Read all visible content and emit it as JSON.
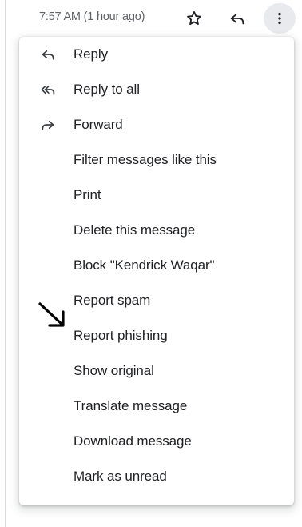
{
  "header": {
    "timestamp": "7:57 AM (1 hour ago)",
    "star_icon": "star-outline-icon",
    "reply_icon": "reply-icon",
    "more_icon": "more-vertical-icon"
  },
  "menu": {
    "items": [
      {
        "label": "Reply",
        "icon": "reply-icon"
      },
      {
        "label": "Reply to all",
        "icon": "reply-all-icon"
      },
      {
        "label": "Forward",
        "icon": "forward-icon"
      },
      {
        "label": "Filter messages like this",
        "icon": ""
      },
      {
        "label": "Print",
        "icon": ""
      },
      {
        "label": "Delete this message",
        "icon": ""
      },
      {
        "label": "Block \"Kendrick Waqar\"",
        "icon": ""
      },
      {
        "label": "Report spam",
        "icon": ""
      },
      {
        "label": "Report phishing",
        "icon": ""
      },
      {
        "label": "Show original",
        "icon": ""
      },
      {
        "label": "Translate message",
        "icon": ""
      },
      {
        "label": "Download message",
        "icon": ""
      },
      {
        "label": "Mark as unread",
        "icon": ""
      }
    ]
  },
  "annotation": {
    "pointer_icon": "pointer-arrow-icon"
  },
  "colors": {
    "text": "#202124",
    "secondary_text": "#5f6368",
    "button_highlight": "#e8eaed"
  }
}
